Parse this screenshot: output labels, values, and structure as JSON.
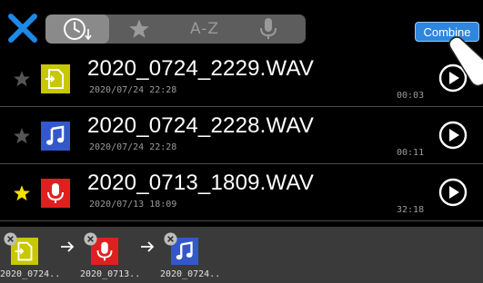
{
  "toolbar": {
    "sort_tabs": [
      {
        "id": "date",
        "icon": "clock-sort-icon",
        "selected": true
      },
      {
        "id": "favorite",
        "icon": "star-icon",
        "selected": false
      },
      {
        "id": "alpha",
        "label": "A-Z",
        "selected": false
      },
      {
        "id": "voice",
        "icon": "microphone-icon",
        "selected": false
      }
    ],
    "combine_label": "Combine"
  },
  "files": [
    {
      "name": "2020_0724_2229.WAV",
      "date": "2020/07/24 22:28",
      "duration": "00:03",
      "favorite": false,
      "type_icon": "import-file-icon",
      "thumb_color": "#c8c800"
    },
    {
      "name": "2020_0724_2228.WAV",
      "date": "2020/07/24 22:28",
      "duration": "00:11",
      "favorite": false,
      "type_icon": "music-note-icon",
      "thumb_color": "#3458c9"
    },
    {
      "name": "2020_0713_1809.WAV",
      "date": "2020/07/13 18:09",
      "duration": "32:18",
      "favorite": true,
      "type_icon": "microphone-icon",
      "thumb_color": "#e02020"
    }
  ],
  "combine_queue": [
    {
      "label": "2020_0724..",
      "type_icon": "import-file-icon"
    },
    {
      "label": "2020_0713..",
      "type_icon": "microphone-icon"
    },
    {
      "label": "2020_0724..",
      "type_icon": "music-note-icon"
    }
  ],
  "colors": {
    "accent": "#2e86de",
    "close_x": "#1e88e5",
    "favorite_star": "#f5e100",
    "inactive_star": "#555555"
  }
}
